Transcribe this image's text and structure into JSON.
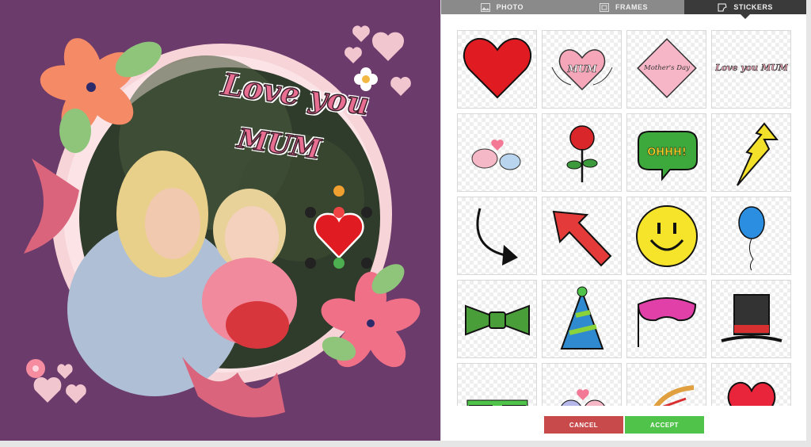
{
  "tabs": [
    {
      "label": "PHOTO",
      "icon": "photo-icon",
      "active": false
    },
    {
      "label": "FRAMES",
      "icon": "frames-icon",
      "active": false
    },
    {
      "label": "STICKERS",
      "icon": "sticker-icon",
      "active": true
    }
  ],
  "canvas": {
    "sticker_text_line1": "Love you",
    "sticker_text_line2": "MUM",
    "background_color": "#6b3b6b"
  },
  "stickers": [
    {
      "name": "red-heart",
      "text": ""
    },
    {
      "name": "mum-heart-banner",
      "text": "MUM"
    },
    {
      "name": "mothers-day-diamond",
      "text": "Mother's Day"
    },
    {
      "name": "love-you-mum-text",
      "text": "Love you MUM"
    },
    {
      "name": "love-birds",
      "text": ""
    },
    {
      "name": "rose",
      "text": ""
    },
    {
      "name": "ohhh-speech-bubble",
      "text": "OHHH!"
    },
    {
      "name": "lightning-arrow",
      "text": ""
    },
    {
      "name": "curved-arrow",
      "text": ""
    },
    {
      "name": "red-arrow",
      "text": ""
    },
    {
      "name": "smiley-face",
      "text": ""
    },
    {
      "name": "blue-balloon",
      "text": ""
    },
    {
      "name": "green-bow-tie",
      "text": ""
    },
    {
      "name": "party-hat",
      "text": ""
    },
    {
      "name": "pink-mask",
      "text": ""
    },
    {
      "name": "top-hat",
      "text": ""
    },
    {
      "name": "green-sunglasses",
      "text": ""
    },
    {
      "name": "cats",
      "text": ""
    },
    {
      "name": "cupid-bow",
      "text": ""
    },
    {
      "name": "heart",
      "text": ""
    }
  ],
  "footer": {
    "cancel_label": "CANCEL",
    "accept_label": "ACCEPT"
  },
  "colors": {
    "cancel": "#c94a4a",
    "accept": "#4fc34a",
    "active_tab": "#3a3a3a",
    "tab_bar": "#8a8a8a"
  }
}
